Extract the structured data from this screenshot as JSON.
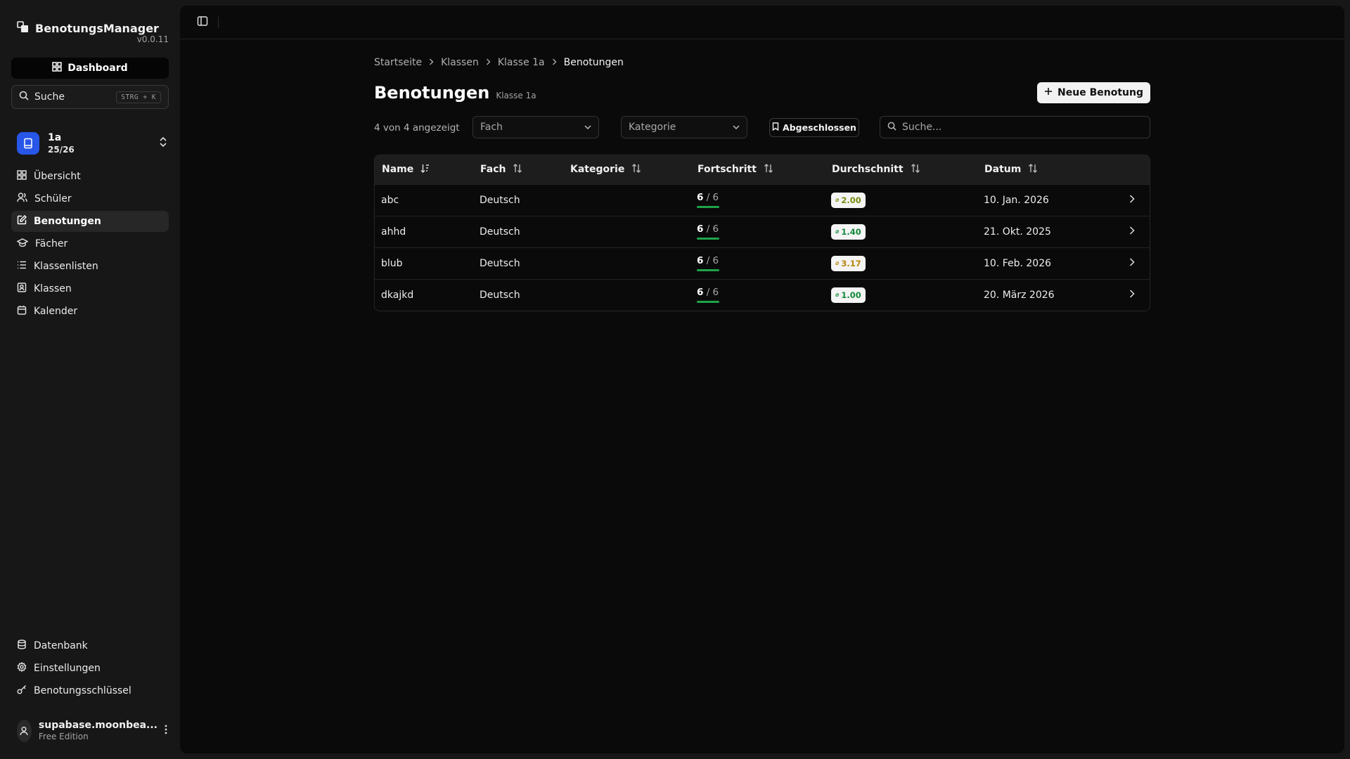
{
  "app": {
    "name": "BenotungsManager",
    "version": "v0.0.11"
  },
  "sidebar": {
    "dashboard_label": "Dashboard",
    "search_label": "Suche",
    "search_shortcut": "STRG + K",
    "class": {
      "name": "1a",
      "year": "25/26"
    },
    "items": [
      {
        "label": "Übersicht",
        "icon": "grid-icon"
      },
      {
        "label": "Schüler",
        "icon": "users-icon"
      },
      {
        "label": "Benotungen",
        "icon": "edit-icon",
        "active": true
      },
      {
        "label": "Fächer",
        "icon": "graduation-cap-icon"
      },
      {
        "label": "Klassenlisten",
        "icon": "list-icon"
      },
      {
        "label": "Klassen",
        "icon": "contact-icon"
      },
      {
        "label": "Kalender",
        "icon": "calendar-icon"
      }
    ],
    "bottom_items": [
      {
        "label": "Datenbank",
        "icon": "database-icon"
      },
      {
        "label": "Einstellungen",
        "icon": "gear-icon"
      },
      {
        "label": "Benotungsschlüssel",
        "icon": "key-icon"
      }
    ],
    "user": {
      "name": "supabase.moonbea...",
      "plan": "Free Edition"
    }
  },
  "breadcrumb": [
    "Startseite",
    "Klassen",
    "Klasse 1a",
    "Benotungen"
  ],
  "page": {
    "title": "Benotungen",
    "subtitle": "Klasse 1a",
    "new_button": "Neue Benotung"
  },
  "filters": {
    "count": "4 von 4 angezeigt",
    "subject_placeholder": "Fach",
    "category_placeholder": "Kategorie",
    "closed_toggle": "Abgeschlossen",
    "search_placeholder": "Suche..."
  },
  "table": {
    "columns": [
      "Name",
      "Fach",
      "Kategorie",
      "Fortschritt",
      "Durchschnitt",
      "Datum"
    ],
    "rows": [
      {
        "name": "abc",
        "subject": "Deutsch",
        "category": "",
        "done": "6",
        "total": "/ 6",
        "average": "2.00",
        "avg_color": "#7a8a10",
        "date": "10. Jan. 2026"
      },
      {
        "name": "ahhd",
        "subject": "Deutsch",
        "category": "",
        "done": "6",
        "total": "/ 6",
        "average": "1.40",
        "avg_color": "#138a3a",
        "date": "21. Okt. 2025"
      },
      {
        "name": "blub",
        "subject": "Deutsch",
        "category": "",
        "done": "6",
        "total": "/ 6",
        "average": "3.17",
        "avg_color": "#b7860b",
        "date": "10. Feb. 2026"
      },
      {
        "name": "dkajkd",
        "subject": "Deutsch",
        "category": "",
        "done": "6",
        "total": "/ 6",
        "average": "1.00",
        "avg_color": "#138a3a",
        "date": "20. März 2026"
      }
    ]
  }
}
